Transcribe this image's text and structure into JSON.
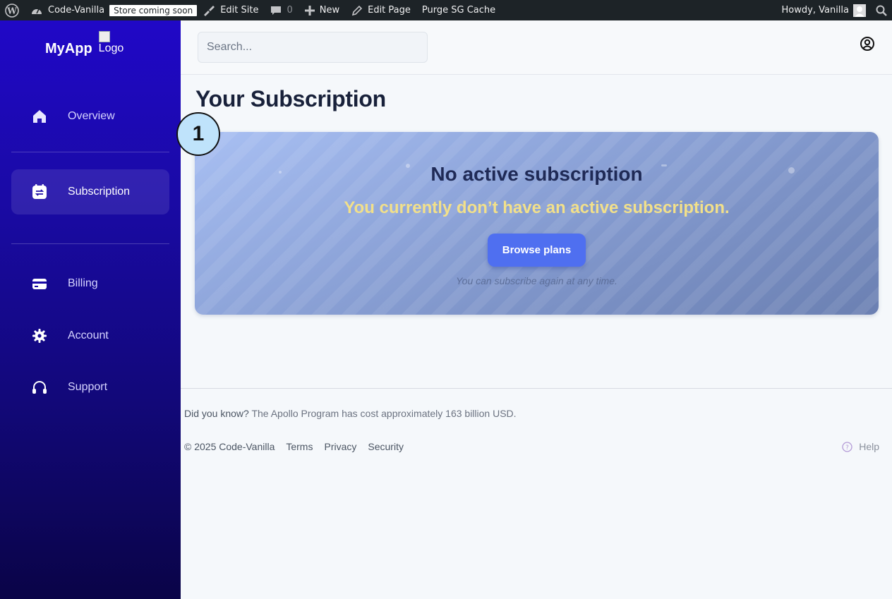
{
  "adminbar": {
    "site_name": "Code-Vanilla",
    "badge": "Store coming soon",
    "edit_site": "Edit Site",
    "comments_count": "0",
    "new": "New",
    "edit_page": "Edit Page",
    "purge": "Purge SG Cache",
    "howdy": "Howdy, Vanilla"
  },
  "sidebar": {
    "brand": "MyApp",
    "logo_alt": "Logo",
    "items": [
      {
        "label": "Overview",
        "icon": "home-icon"
      },
      {
        "label": "Subscription",
        "icon": "subscription-icon",
        "active": true
      },
      {
        "label": "Billing",
        "icon": "credit-card-icon"
      },
      {
        "label": "Account",
        "icon": "gear-icon"
      },
      {
        "label": "Support",
        "icon": "headset-icon"
      }
    ]
  },
  "topbar": {
    "search_placeholder": "Search..."
  },
  "main": {
    "title": "Your Subscription",
    "step_badge": "1",
    "card": {
      "title": "No active subscription",
      "subtitle": "You currently don’t have an active subscription.",
      "button": "Browse plans",
      "note": "You can subscribe again at any time."
    }
  },
  "footer": {
    "fact_label": "Did you know?",
    "fact_text": "The Apollo Program has cost approximately 163 billion USD.",
    "copyright": "© 2025 Code-Vanilla",
    "links": [
      "Terms",
      "Privacy",
      "Security"
    ],
    "help": "Help"
  },
  "colors": {
    "sidebar_top": "#2008c7",
    "sidebar_bottom": "#0a0447",
    "accent_button": "#4f6ff0",
    "card_subtitle": "#f2e08a",
    "title": "#18213a"
  }
}
